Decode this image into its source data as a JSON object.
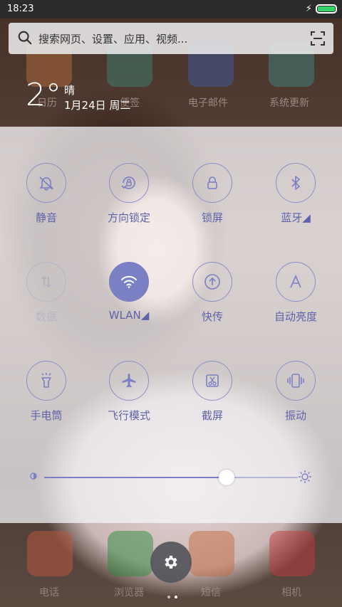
{
  "status_bar": {
    "time": "18:23",
    "battery_level": 1.0,
    "charging": true,
    "battery_color": "#36d36d"
  },
  "search": {
    "placeholder": "搜索网页、设置、应用、视频..."
  },
  "weather": {
    "temp": "2°",
    "condition": "晴",
    "date": "1月24日 周二"
  },
  "launcher_top_apps": [
    {
      "label": "日历",
      "icon": "calendar-icon"
    },
    {
      "label": "便签",
      "icon": "notes-icon"
    },
    {
      "label": "电子邮件",
      "icon": "mail-icon"
    },
    {
      "label": "系统更新",
      "icon": "update-icon"
    }
  ],
  "toggles": [
    {
      "label": "静音",
      "icon": "bell-off-icon",
      "state": "off"
    },
    {
      "label": "方向锁定",
      "icon": "rotation-lock-icon",
      "state": "off"
    },
    {
      "label": "锁屏",
      "icon": "lock-icon",
      "state": "off"
    },
    {
      "label": "蓝牙◢",
      "icon": "bluetooth-icon",
      "state": "off"
    },
    {
      "label": "数据",
      "icon": "data-arrows-icon",
      "state": "disabled"
    },
    {
      "label": "WLAN◢",
      "icon": "wifi-icon",
      "state": "on"
    },
    {
      "label": "快传",
      "icon": "upload-icon",
      "state": "off"
    },
    {
      "label": "自动亮度",
      "icon": "auto-brightness-icon",
      "state": "off"
    },
    {
      "label": "手电筒",
      "icon": "flashlight-icon",
      "state": "off"
    },
    {
      "label": "飞行模式",
      "icon": "airplane-icon",
      "state": "off"
    },
    {
      "label": "截屏",
      "icon": "screenshot-icon",
      "state": "off"
    },
    {
      "label": "振动",
      "icon": "vibrate-icon",
      "state": "off"
    }
  ],
  "brightness": {
    "level": 0.72,
    "accent": "#7b7fc4"
  },
  "dock_apps": [
    {
      "label": "电话",
      "icon": "phone-icon"
    },
    {
      "label": "浏览器",
      "icon": "browser-icon"
    },
    {
      "label": "短信",
      "icon": "sms-icon"
    },
    {
      "label": "相机",
      "icon": "camera-icon"
    }
  ],
  "settings_button": {
    "icon": "gear-icon"
  },
  "page_indicator": {
    "pages": 2,
    "active": 2
  }
}
